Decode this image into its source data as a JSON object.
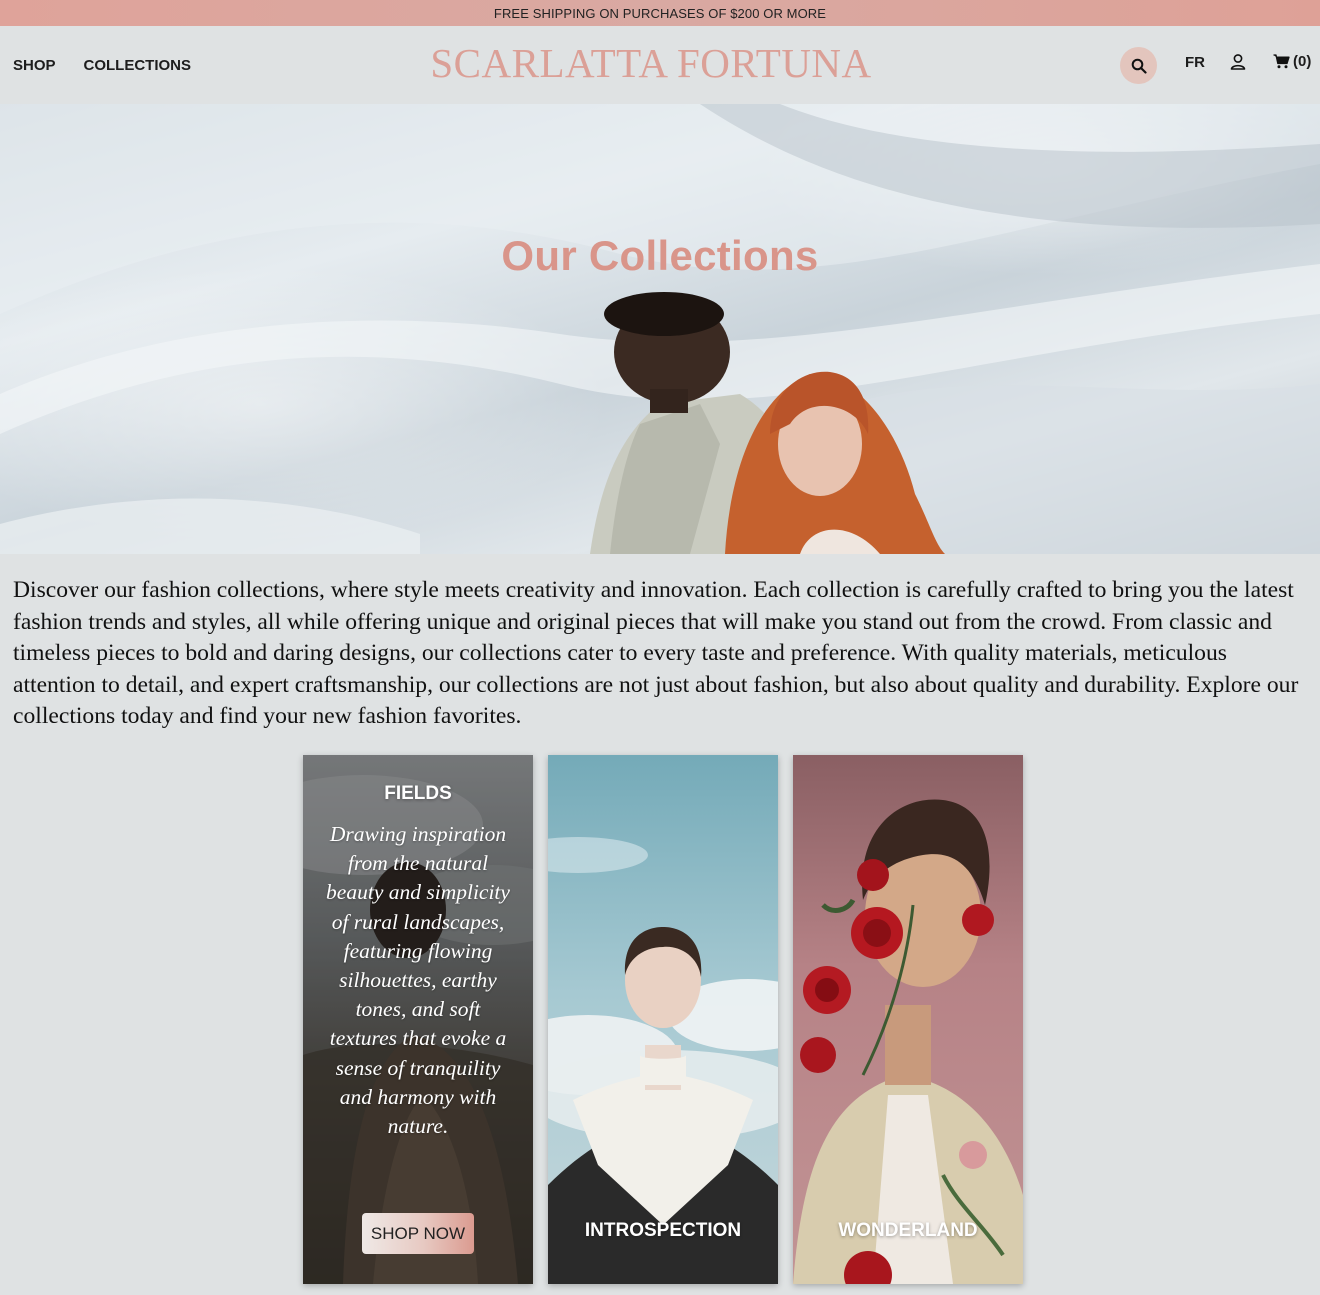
{
  "colors": {
    "accent": "#d9958a",
    "logo": "#dba097",
    "page_background": "#dfe2e3",
    "promo_bar": "#dba59d"
  },
  "promo": {
    "text": "FREE SHIPPING ON PURCHASES OF $200 OR MORE"
  },
  "header": {
    "nav": [
      {
        "label": "SHOP"
      },
      {
        "label": "COLLECTIONS"
      }
    ],
    "logo": "SCARLATTA FORTUNA",
    "language": "FR",
    "cart_count": "(0)",
    "icons": [
      "search-icon",
      "account-icon",
      "cart-icon"
    ]
  },
  "hero": {
    "title": "Our Collections"
  },
  "intro": {
    "text": "Discover our fashion collections, where style meets creativity and innovation. Each collection is carefully crafted to bring you the latest fashion trends and styles, all while offering unique and original pieces that will make you stand out from the crowd. From classic and timeless pieces to bold and daring designs, our collections cater to every taste and preference. With quality materials, meticulous attention to detail, and expert craftsmanship, our collections are not just about fashion, but also about quality and durability. Explore our collections today and find your new fashion favorites."
  },
  "collections": [
    {
      "name": "FIELDS",
      "description": "Drawing inspiration from the natural beauty and simplicity of rural landscapes, featuring flowing silhouettes, earthy tones, and soft textures that evoke a sense of tranquility and harmony with nature.",
      "cta": "SHOP NOW"
    },
    {
      "name": "INTROSPECTION"
    },
    {
      "name": "WONDERLAND"
    }
  ]
}
